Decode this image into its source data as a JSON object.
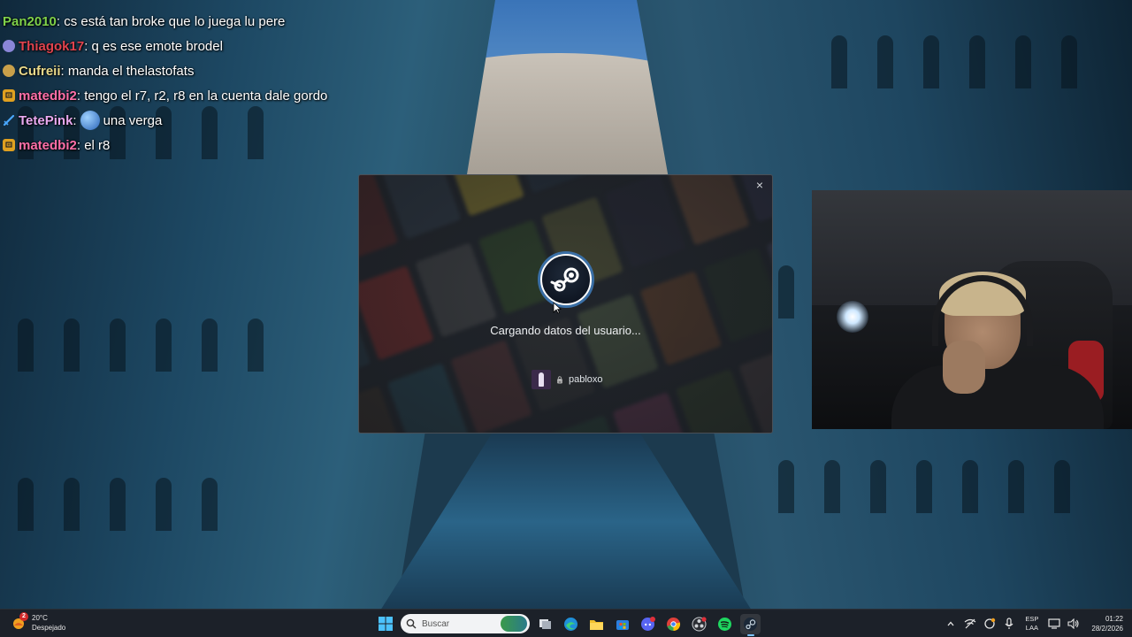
{
  "chat": {
    "messages": [
      {
        "badge": "none",
        "badge_color": "",
        "name": "Pan2010",
        "name_color": "#7fd14a",
        "text": ": cs está tan broke que lo juega lu pere"
      },
      {
        "badge": "mod",
        "badge_color": "#8a86d8",
        "name": "Thiagok17",
        "name_color": "#e0434e",
        "text": ": q es ese emote brodel"
      },
      {
        "badge": "sub",
        "badge_color": "#c9a04a",
        "name": "Cufreii",
        "name_color": "#e8d88a",
        "text": ": manda el thelastofats"
      },
      {
        "badge": "twitch",
        "badge_color": "#e0a020",
        "name": "matedbi2",
        "name_color": "#ff6fa8",
        "text": ": tengo el r7, r2, r8 en la cuenta dale gordo"
      },
      {
        "badge": "sword",
        "badge_color": "#4aa8ff",
        "name": "TetePink",
        "name_color": "#e8a9f0",
        "text": ":",
        "emote": true,
        "text2": "una verga"
      },
      {
        "badge": "twitch",
        "badge_color": "#e0a020",
        "name": "matedbi2",
        "name_color": "#ff6fa8",
        "text": ": el r8"
      }
    ]
  },
  "steam": {
    "close_label": "×",
    "status": "Cargando datos del usuario...",
    "username": "pabloxo",
    "lock_symbol": "🔒"
  },
  "taskbar": {
    "weather": {
      "temp": "20°C",
      "condition": "Despejado",
      "badge": "2"
    },
    "search": {
      "placeholder": "Buscar"
    },
    "language": {
      "line1": "ESP",
      "line2": "LAA"
    },
    "clock": {
      "time": "01:22",
      "date": "28/2/2026"
    },
    "apps": [
      "start",
      "search",
      "task-view",
      "edge",
      "file-explorer",
      "store",
      "discord",
      "chrome",
      "obs",
      "spotify",
      "steam"
    ]
  }
}
